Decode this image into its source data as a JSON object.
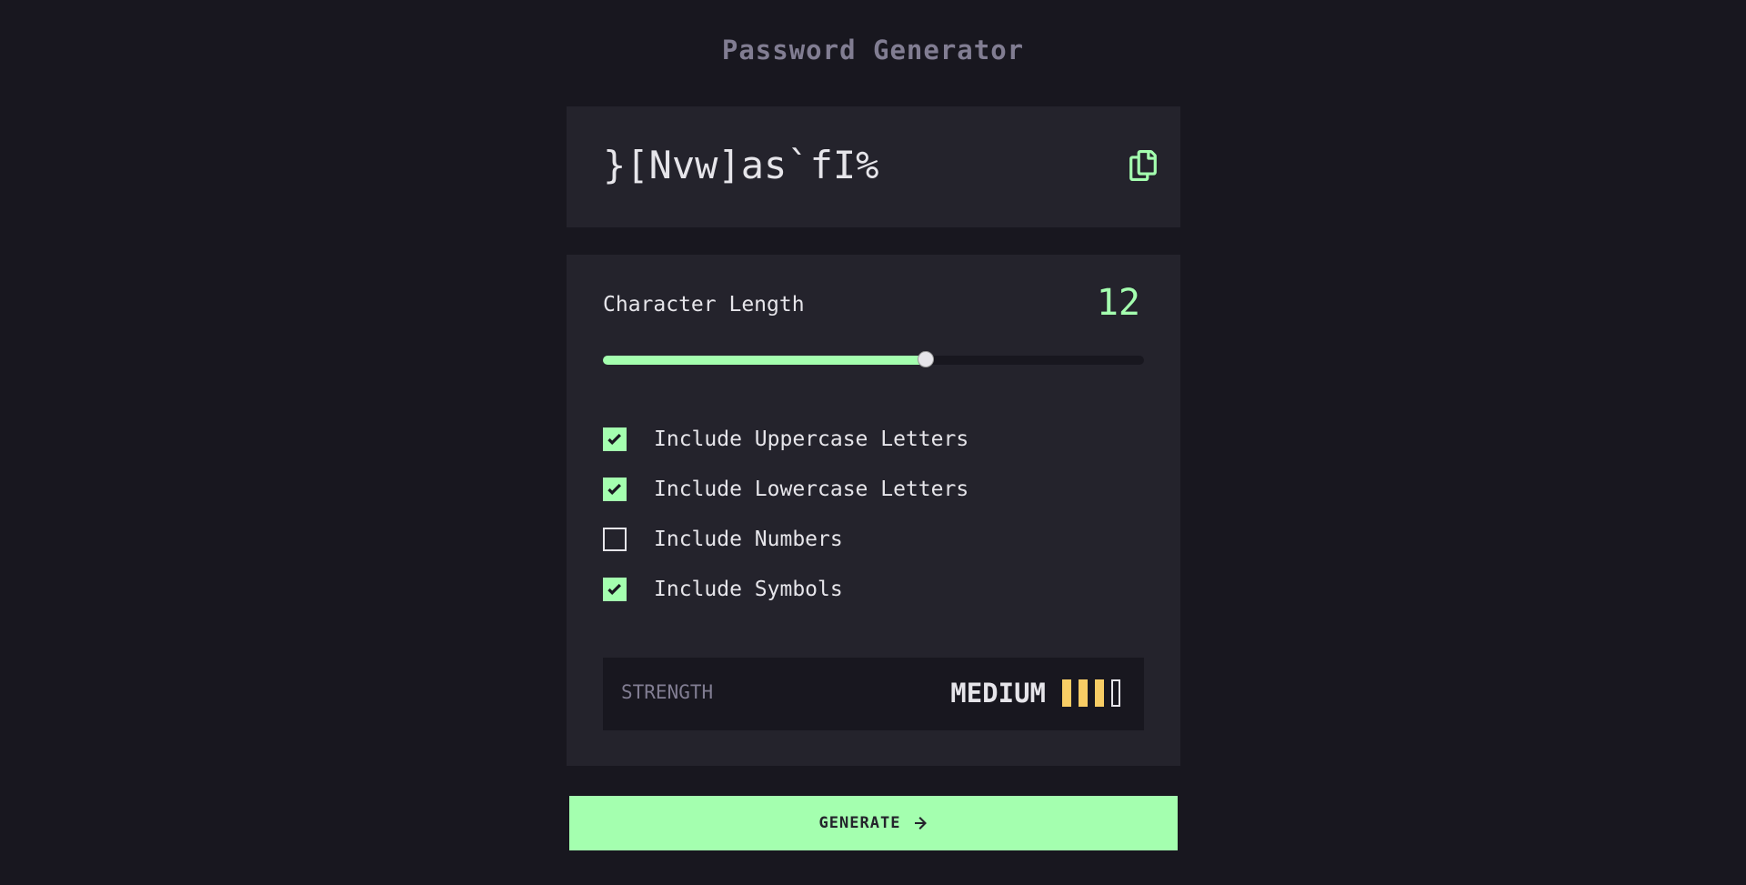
{
  "app": {
    "title": "Password Generator"
  },
  "password": {
    "value": "}[Nvw]as`fI%",
    "copy_icon": "copy-icon"
  },
  "length": {
    "label": "Character Length",
    "value": "12",
    "slider_fraction": 0.596
  },
  "options": [
    {
      "label": "Include Uppercase Letters",
      "checked": true
    },
    {
      "label": "Include Lowercase Letters",
      "checked": true
    },
    {
      "label": "Include Numbers",
      "checked": false
    },
    {
      "label": "Include Symbols",
      "checked": true
    }
  ],
  "strength": {
    "label": "STRENGTH",
    "value": "MEDIUM",
    "level": 3,
    "max_level": 4
  },
  "generate": {
    "label": "GENERATE",
    "icon": "arrow-right-icon"
  },
  "colors": {
    "background": "#18171f",
    "panel": "#24232c",
    "accent": "#a4ffaf",
    "muted": "#817d92",
    "text": "#e6e5ea",
    "strength_medium": "#f8cd65"
  }
}
